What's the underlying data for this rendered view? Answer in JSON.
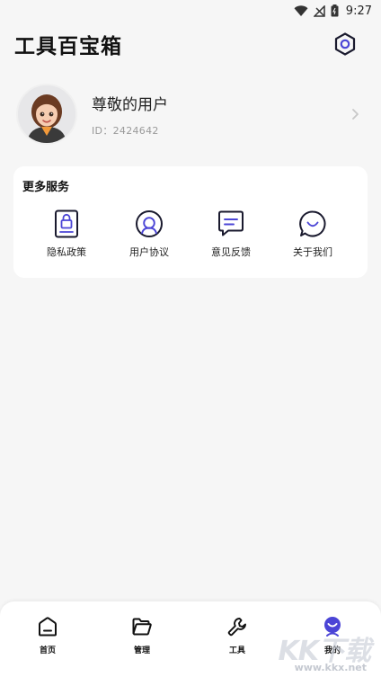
{
  "status_bar": {
    "time": "9:27"
  },
  "header": {
    "title": "工具百宝箱"
  },
  "profile": {
    "username": "尊敬的用户",
    "user_id": "ID：2424642"
  },
  "services": {
    "title": "更多服务",
    "items": [
      {
        "label": "隐私政策",
        "icon": "privacy-lock-icon"
      },
      {
        "label": "用户协议",
        "icon": "user-agreement-icon"
      },
      {
        "label": "意见反馈",
        "icon": "feedback-icon"
      },
      {
        "label": "关于我们",
        "icon": "about-chat-icon"
      }
    ]
  },
  "tabs": [
    {
      "label": "首页",
      "icon": "home-icon"
    },
    {
      "label": "管理",
      "icon": "folder-icon"
    },
    {
      "label": "工具",
      "icon": "wrench-icon"
    },
    {
      "label": "我的",
      "icon": "profile-icon",
      "active": true
    }
  ],
  "watermark": {
    "text": "KK下载",
    "url": "www.kkx.net"
  },
  "colors": {
    "accent": "#4b45d6",
    "background": "#f6f6f6",
    "card": "#ffffff"
  }
}
